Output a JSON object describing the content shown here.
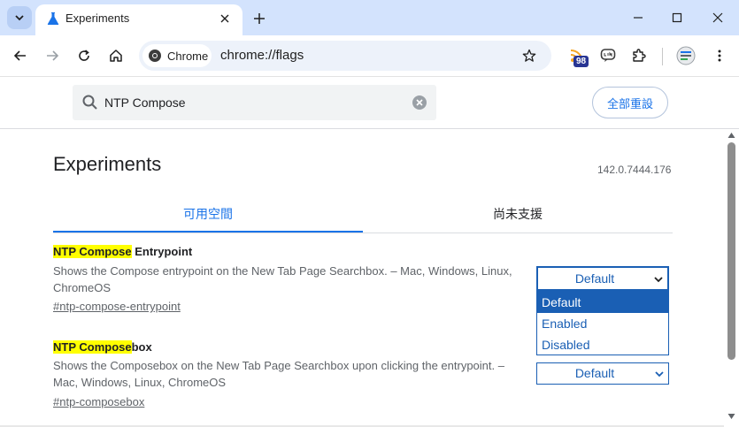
{
  "browser": {
    "tab_title": "Experiments",
    "site_chip_label": "Chrome",
    "url": "chrome://flags",
    "extension_badge": "98"
  },
  "search": {
    "value": "NTP Compose",
    "reset_all_label": "全部重設"
  },
  "page": {
    "title": "Experiments",
    "version": "142.0.7444.176",
    "tabs": [
      {
        "label": "可用空間",
        "active": true
      },
      {
        "label": "尚未支援",
        "active": false
      }
    ]
  },
  "experiments": [
    {
      "title_highlight": "NTP Compose",
      "title_rest": " Entrypoint",
      "description_line1": "Shows the Compose entrypoint on the New Tab Page Searchbox. – Mac, Windows, Linux,",
      "description_line2": "ChromeOS",
      "link": "#ntp-compose-entrypoint",
      "selected": "Default",
      "dropdown_open": true,
      "options": [
        "Default",
        "Enabled",
        "Disabled"
      ]
    },
    {
      "title_highlight": "NTP Compose",
      "title_rest": "box",
      "description_line1": "Shows the Composebox on the New Tab Page Searchbox upon clicking the entrypoint. –",
      "description_line2": "Mac, Windows, Linux, ChromeOS",
      "link": "#ntp-composebox",
      "selected": "Default",
      "dropdown_open": false
    }
  ],
  "colors": {
    "accent": "#1a73e8",
    "select_blue": "#1a5fb4",
    "highlight": "#ffff00",
    "titlebar": "#d3e3fd"
  }
}
